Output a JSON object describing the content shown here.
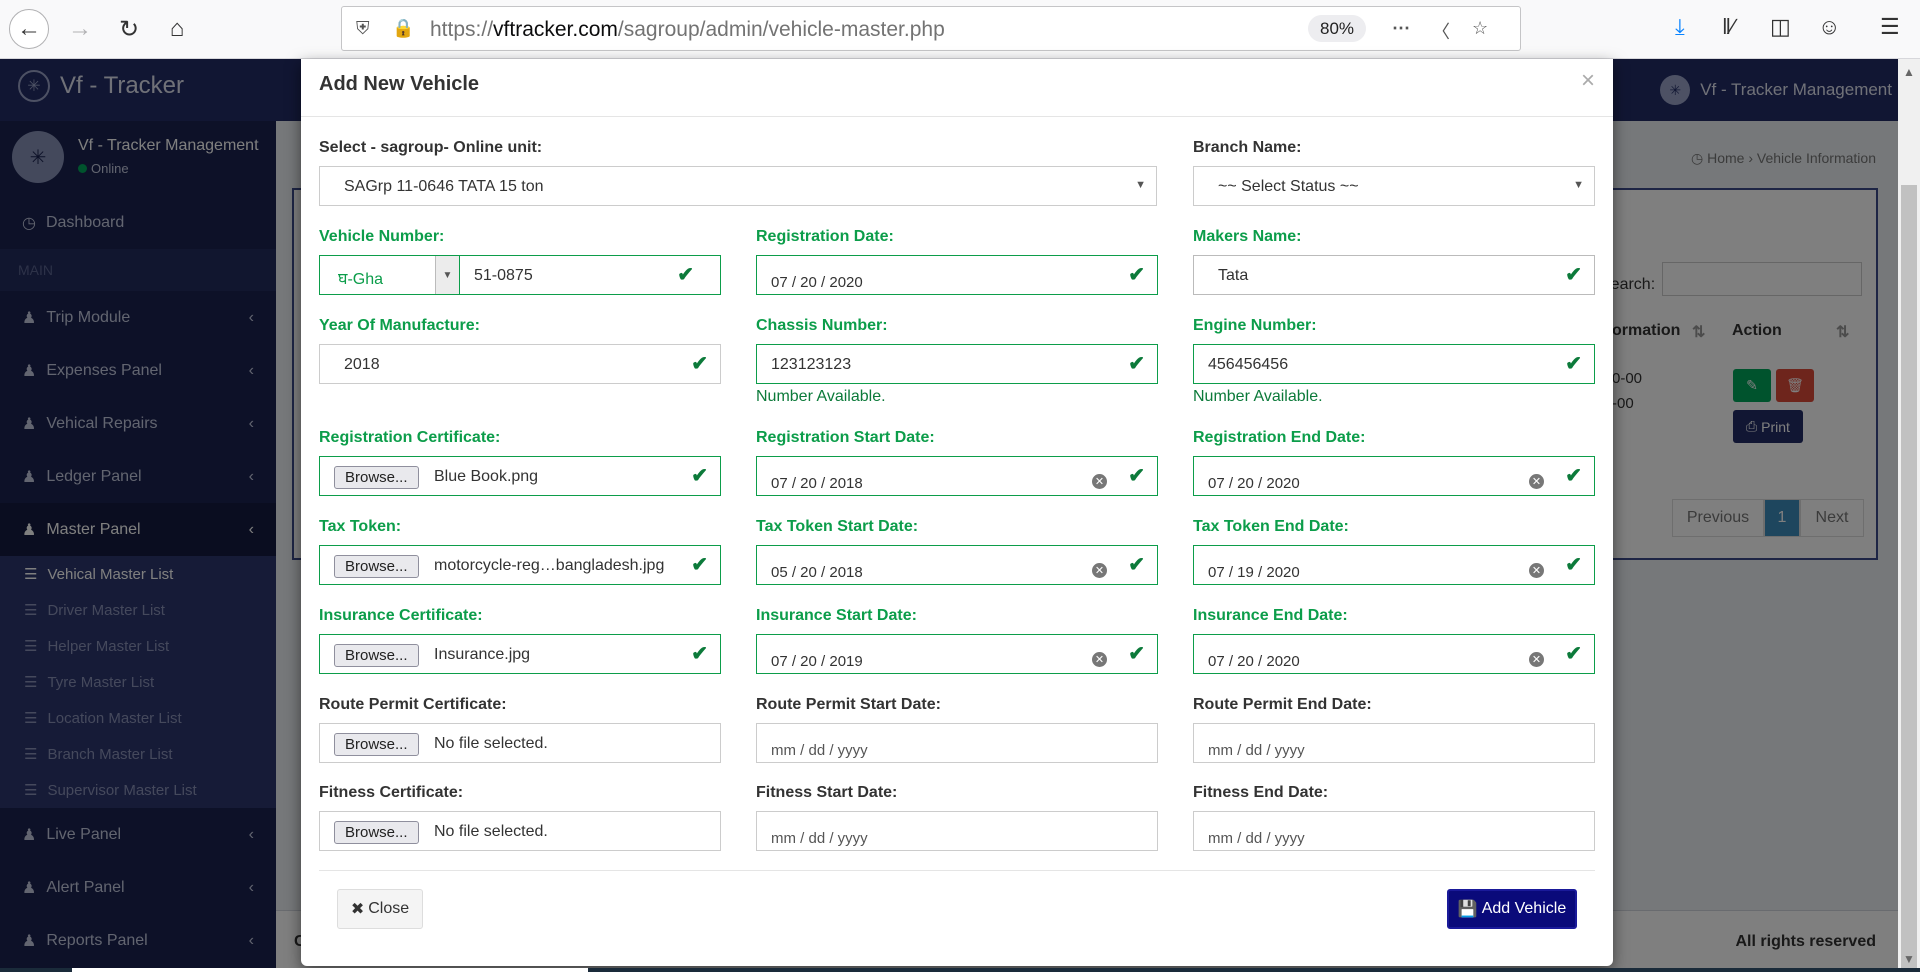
{
  "browser": {
    "url_prefix": "https://",
    "url_domain": "vftracker.com",
    "url_path": "/sagroup/admin/vehicle-master.php",
    "zoom": "80%"
  },
  "app": {
    "brand": "Vf - Tracker",
    "header_right": "Vf - Tracker Management",
    "user_name": "Vf - Tracker Management",
    "user_status": "Online",
    "breadcrumb_home": "Home",
    "breadcrumb_current": "Vehicle Information",
    "search_label": "Search:",
    "col_info": "ormation",
    "col_action": "Action",
    "cell_1": "0-00",
    "cell_2": "-00",
    "print_label": "Print",
    "prev_label": "Previous",
    "page_1": "1",
    "next_label": "Next",
    "footer_right": "All rights reserved",
    "footer_left": "C"
  },
  "sidebar": {
    "dashboard": "Dashboard",
    "section": "MAIN",
    "items": [
      {
        "label": "Trip Module"
      },
      {
        "label": "Expenses Panel"
      },
      {
        "label": "Vehical Repairs"
      },
      {
        "label": "Ledger Panel"
      },
      {
        "label": "Master Panel"
      }
    ],
    "sub_items": [
      {
        "label": "Vehical Master List"
      },
      {
        "label": "Driver Master List"
      },
      {
        "label": "Helper Master List"
      },
      {
        "label": "Tyre Master List"
      },
      {
        "label": "Location Master List"
      },
      {
        "label": "Branch Master List"
      },
      {
        "label": "Supervisor Master List"
      }
    ],
    "items_after": [
      {
        "label": "Live Panel"
      },
      {
        "label": "Alert Panel"
      },
      {
        "label": "Reports Panel"
      }
    ]
  },
  "modal": {
    "title": "Add New Vehicle",
    "close_x": "×",
    "unit_label": "Select - sagroup- Online unit:",
    "unit_value": "SAGrp 11-0646 TATA 15 ton",
    "branch_label": "Branch Name:",
    "branch_value": "~~ Select Status ~~",
    "vehicle_number_label": "Vehicle Number:",
    "vehicle_prefix": "घ-Gha",
    "vehicle_number": "51-0875",
    "reg_date_label": "Registration Date:",
    "reg_date": "07 / 20 / 2020",
    "maker_label": "Makers Name:",
    "maker": "Tata",
    "yom_label": "Year Of Manufacture:",
    "yom": "2018",
    "chassis_label": "Chassis Number:",
    "chassis": "123123123",
    "chassis_help": "Number Available.",
    "engine_label": "Engine Number:",
    "engine": "456456456",
    "engine_help": "Number Available.",
    "reg_cert_label": "Registration Certificate:",
    "reg_cert_file": "Blue Book.png",
    "reg_start_label": "Registration Start Date:",
    "reg_start": "07 / 20 / 2018",
    "reg_end_label": "Registration End Date:",
    "reg_end": "07 / 20 / 2020",
    "tax_label": "Tax Token:",
    "tax_file": "motorcycle-reg…bangladesh.jpg",
    "tax_start_label": "Tax Token Start Date:",
    "tax_start": "05 / 20 / 2018",
    "tax_end_label": "Tax Token End Date:",
    "tax_end": "07 / 19 / 2020",
    "ins_label": "Insurance Certificate:",
    "ins_file": "Insurance.jpg",
    "ins_start_label": "Insurance Start Date:",
    "ins_start": "07 / 20 / 2019",
    "ins_end_label": "Insurance End Date:",
    "ins_end": "07 / 20 / 2020",
    "route_label": "Route Permit Certificate:",
    "route_file": "No file selected.",
    "route_start_label": "Route Permit Start Date:",
    "route_end_label": "Route Permit End Date:",
    "fit_label": "Fitness Certificate:",
    "fit_file": "No file selected.",
    "fit_start_label": "Fitness Start Date:",
    "fit_end_label": "Fitness End Date:",
    "date_placeholder": "mm / dd / yyyy",
    "browse_label": "Browse...",
    "close_btn": "Close",
    "add_btn": "Add Vehicle"
  },
  "colors": {
    "valid_green": "#0c9d4a",
    "primary": "#0a0a7a",
    "header": "#222d67"
  }
}
